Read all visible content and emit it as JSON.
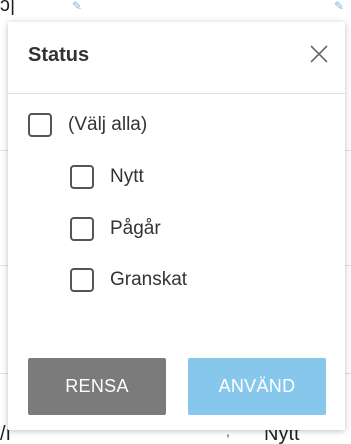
{
  "background": {
    "top_fragment": "ɔ|",
    "bottom_left_fragment": "/ı",
    "bottom_right_fragment": "Nytt",
    "bottom_mark": ", '"
  },
  "popup": {
    "title": "Status",
    "options": [
      {
        "label": "(Välj alla)",
        "checked": false
      },
      {
        "label": "Nytt",
        "checked": false
      },
      {
        "label": "Pågår",
        "checked": false
      },
      {
        "label": "Granskat",
        "checked": false
      }
    ],
    "clear_label": "RENSA",
    "apply_label": "ANVÄND"
  },
  "colors": {
    "clear_button": "#7b7b7b",
    "apply_button": "#87c7ec",
    "checkbox_border": "#555555"
  },
  "icons": {
    "close": "close-icon",
    "edit": "pencil-icon"
  }
}
